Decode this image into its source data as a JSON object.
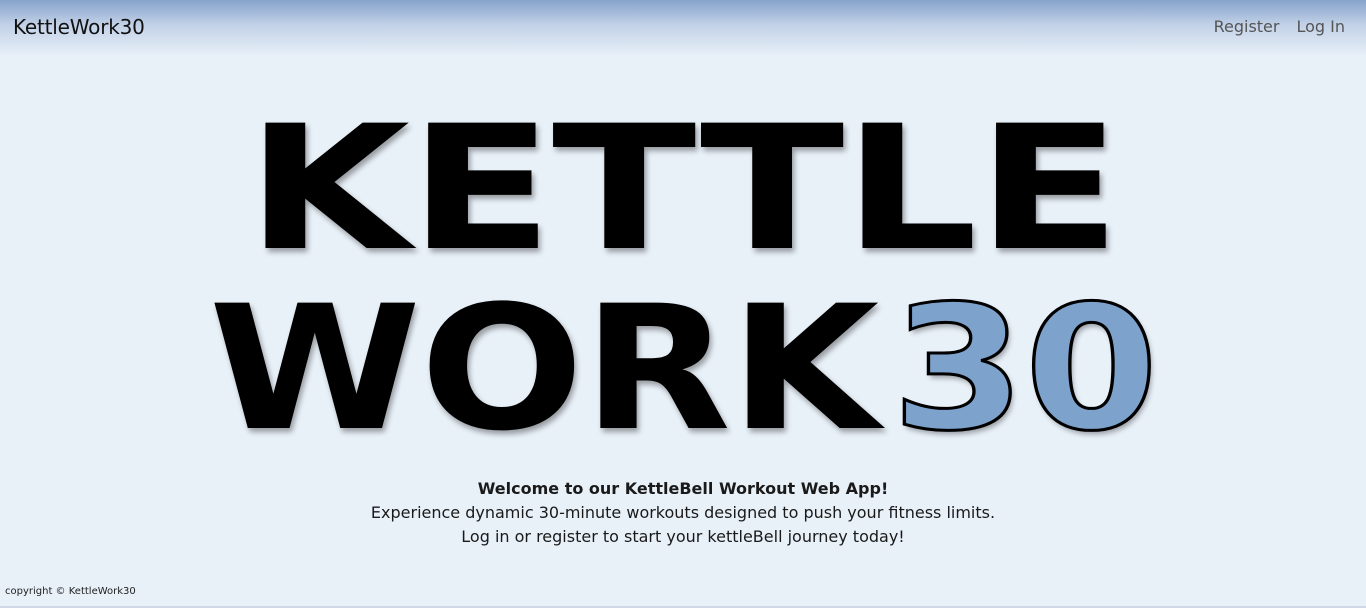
{
  "navbar": {
    "brand": "KettleWork30",
    "links": [
      "Register",
      "Log In"
    ]
  },
  "hero": {
    "line1": "KETTLE",
    "line2_word": "WORK",
    "line2_number": "30",
    "accent_color": "#7da2cc"
  },
  "welcome": {
    "title": "Welcome to our KettleBell Workout Web App!",
    "line1": "Experience dynamic 30-minute workouts designed to push your fitness limits.",
    "line2": "Log in or register to start your kettleBell journey today!"
  },
  "footer": {
    "copyright": "copyright © KettleWork30"
  }
}
